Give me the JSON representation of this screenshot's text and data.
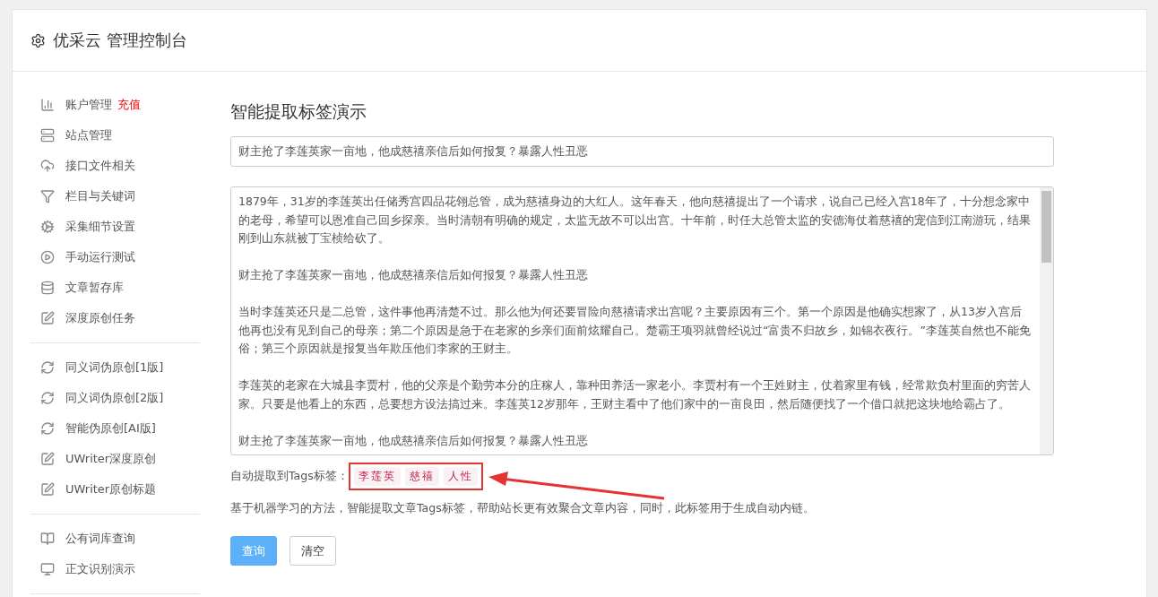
{
  "header": {
    "title": "优采云 管理控制台"
  },
  "sidebar": {
    "groups": [
      {
        "items": [
          {
            "label": "账户管理",
            "badge": "充值"
          },
          {
            "label": "站点管理"
          },
          {
            "label": "接口文件相关"
          },
          {
            "label": "栏目与关键词"
          },
          {
            "label": "采集细节设置"
          },
          {
            "label": "手动运行测试"
          },
          {
            "label": "文章暂存库"
          },
          {
            "label": "深度原创任务"
          }
        ]
      },
      {
        "items": [
          {
            "label": "同义词伪原创[1版]"
          },
          {
            "label": "同义词伪原创[2版]"
          },
          {
            "label": "智能伪原创[AI版]"
          },
          {
            "label": "UWriter深度原创"
          },
          {
            "label": "UWriter原创标题"
          }
        ]
      },
      {
        "items": [
          {
            "label": "公有词库查询"
          },
          {
            "label": "正文识别演示"
          }
        ]
      }
    ]
  },
  "main": {
    "title": "智能提取标签演示",
    "title_field": {
      "value": "财主抢了李莲英家一亩地，他成慈禧亲信后如何报复？暴露人性丑恶"
    },
    "content_field": {
      "paragraphs": [
        "1879年，31岁的李莲英出任储秀宫四品花翎总管，成为慈禧身边的大红人。这年春天，他向慈禧提出了一个请求，说自己已经入宫18年了，十分想念家中的老母，希望可以恩准自己回乡探亲。当时清朝有明确的规定，太监无故不可以出宫。十年前，时任大总管太监的安德海仗着慈禧的宠信到江南游玩，结果刚到山东就被丁宝桢给砍了。",
        "财主抢了李莲英家一亩地，他成慈禧亲信后如何报复？暴露人性丑恶",
        "当时李莲英还只是二总管，这件事他再清楚不过。那么他为何还要冒险向慈禧请求出宫呢？主要原因有三个。第一个原因是他确实想家了，从13岁入宫后他再也没有见到自己的母亲；第二个原因是急于在老家的乡亲们面前炫耀自己。楚霸王项羽就曾经说过“富贵不归故乡，如锦衣夜行。”李莲英自然也不能免俗；第三个原因就是报复当年欺压他们李家的王财主。",
        "李莲英的老家在大城县李贾村，他的父亲是个勤劳本分的庄稼人，靠种田养活一家老小。李贾村有一个王姓财主，仗着家里有钱，经常欺负村里面的穷苦人家。只要是他看上的东西，总要想方设法搞过来。李莲英12岁那年，王财主看中了他们家中的一亩良田，然后随便找了一个借口就把这块地给霸占了。",
        "财主抢了李莲英家一亩地，他成慈禧亲信后如何报复？暴露人性丑恶"
      ]
    },
    "tags_label": "自动提取到Tags标签：",
    "tags": [
      "李莲英",
      "慈禧",
      "人性"
    ],
    "description": "基于机器学习的方法，智能提取文章Tags标签，帮助站长更有效聚合文章内容，同时，此标签用于生成自动内链。",
    "buttons": [
      {
        "label": "查询",
        "kind": "primary"
      },
      {
        "label": "清空",
        "kind": "default"
      }
    ]
  }
}
